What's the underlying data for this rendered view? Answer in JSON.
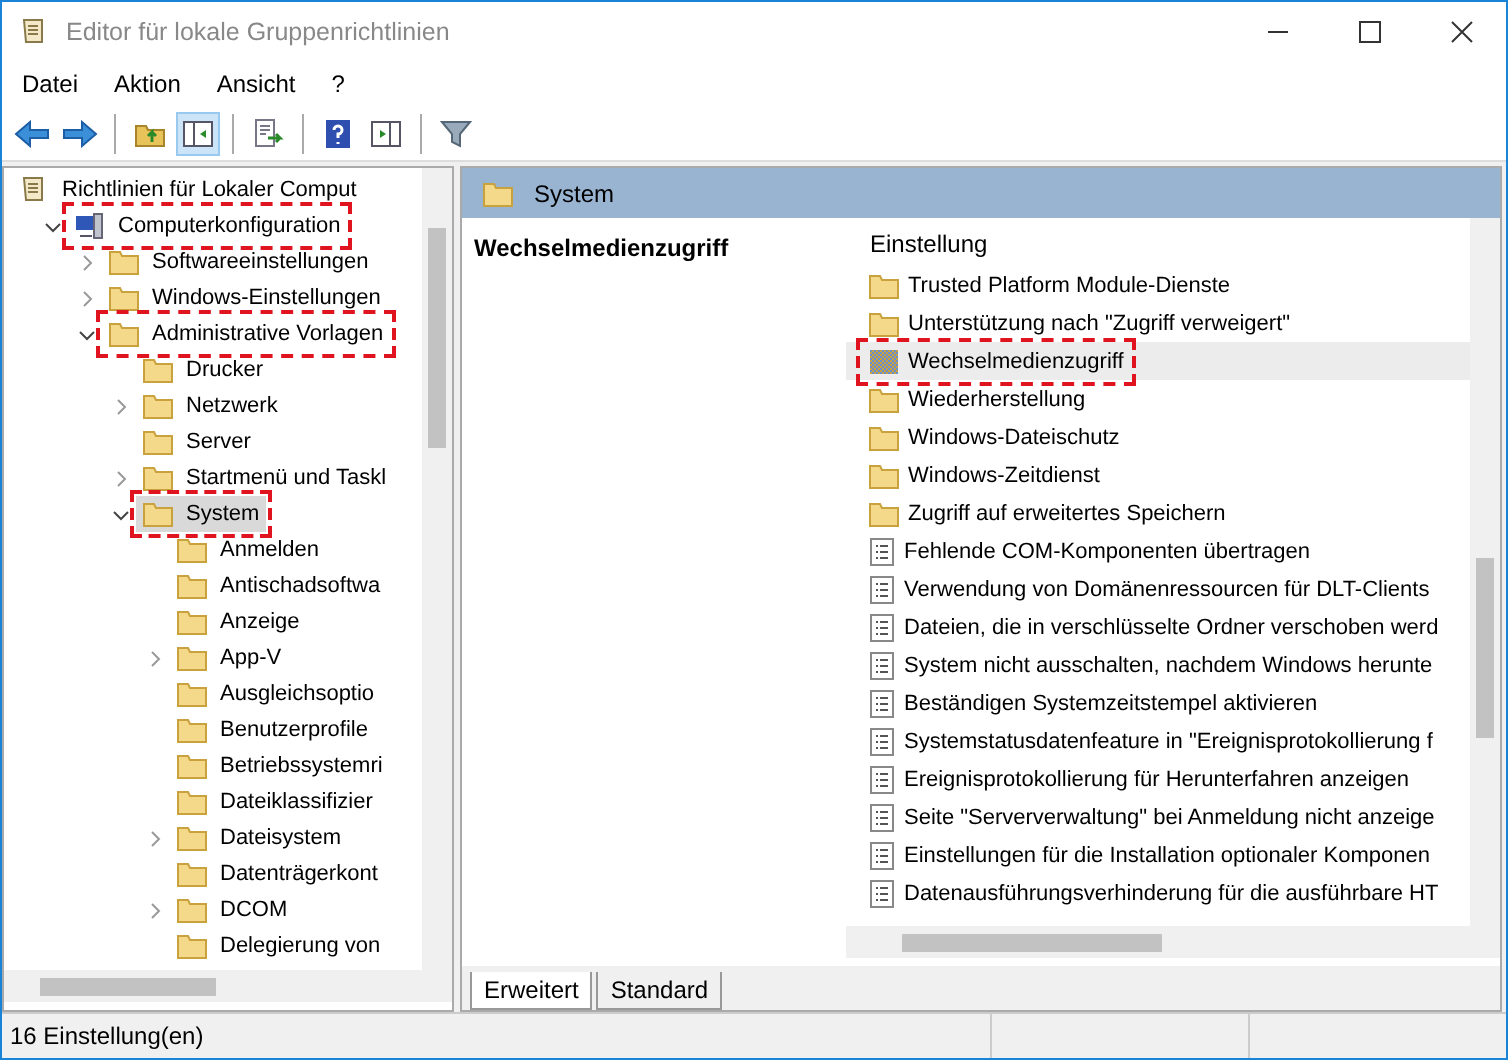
{
  "window": {
    "title": "Editor für lokale Gruppenrichtlinien"
  },
  "menu": [
    "Datei",
    "Aktion",
    "Ansicht",
    "?"
  ],
  "toolbar": [
    {
      "kind": "back",
      "pressed": false
    },
    {
      "kind": "forward",
      "pressed": false
    },
    {
      "kind": "separator"
    },
    {
      "kind": "up",
      "pressed": false
    },
    {
      "kind": "tree",
      "pressed": true
    },
    {
      "kind": "separator"
    },
    {
      "kind": "export",
      "pressed": false
    },
    {
      "kind": "separator"
    },
    {
      "kind": "help",
      "pressed": false
    },
    {
      "kind": "pane",
      "pressed": false
    },
    {
      "kind": "separator"
    },
    {
      "kind": "filter",
      "pressed": false
    }
  ],
  "tree": {
    "label": "Richtlinien für Lokaler Comput",
    "kind": "scroll",
    "selected": false,
    "highlighted": false,
    "children": [
      {
        "label": "Computerkonfiguration",
        "kind": "computer",
        "expanded": true,
        "selected": false,
        "highlighted": true,
        "children": [
          {
            "label": "Softwareeinstellungen",
            "kind": "folder",
            "expanded": false,
            "selected": false,
            "highlighted": false
          },
          {
            "label": "Windows-Einstellungen",
            "kind": "folder",
            "expanded": false,
            "selected": false,
            "highlighted": false
          },
          {
            "label": "Administrative Vorlagen",
            "kind": "folder",
            "expanded": true,
            "selected": false,
            "highlighted": true,
            "children": [
              {
                "label": "Drucker",
                "kind": "folder",
                "selected": false,
                "highlighted": false
              },
              {
                "label": "Netzwerk",
                "kind": "folder",
                "expanded": false,
                "selected": false,
                "highlighted": false
              },
              {
                "label": "Server",
                "kind": "folder",
                "selected": false,
                "highlighted": false
              },
              {
                "label": "Startmenü und Taskl",
                "kind": "folder",
                "expanded": false,
                "selected": false,
                "highlighted": false
              },
              {
                "label": "System",
                "kind": "folder",
                "expanded": true,
                "selected": true,
                "highlighted": true,
                "children": [
                  {
                    "label": "Anmelden",
                    "kind": "folder",
                    "selected": false,
                    "highlighted": false
                  },
                  {
                    "label": "Antischadsoftwa",
                    "kind": "folder",
                    "selected": false,
                    "highlighted": false
                  },
                  {
                    "label": "Anzeige",
                    "kind": "folder",
                    "selected": false,
                    "highlighted": false
                  },
                  {
                    "label": "App-V",
                    "kind": "folder",
                    "expanded": false,
                    "selected": false,
                    "highlighted": false
                  },
                  {
                    "label": "Ausgleichsoptio",
                    "kind": "folder",
                    "selected": false,
                    "highlighted": false
                  },
                  {
                    "label": "Benutzerprofile",
                    "kind": "folder",
                    "selected": false,
                    "highlighted": false
                  },
                  {
                    "label": "Betriebssystemri",
                    "kind": "folder",
                    "selected": false,
                    "highlighted": false
                  },
                  {
                    "label": "Dateiklassifizier",
                    "kind": "folder",
                    "selected": false,
                    "highlighted": false
                  },
                  {
                    "label": "Dateisystem",
                    "kind": "folder",
                    "expanded": false,
                    "selected": false,
                    "highlighted": false
                  },
                  {
                    "label": "Datenträgerkont",
                    "kind": "folder",
                    "selected": false,
                    "highlighted": false
                  },
                  {
                    "label": "DCOM",
                    "kind": "folder",
                    "expanded": false,
                    "selected": false,
                    "highlighted": false
                  },
                  {
                    "label": "Delegierung von",
                    "kind": "folder",
                    "selected": false,
                    "highlighted": false
                  }
                ]
              }
            ]
          }
        ]
      }
    ]
  },
  "content_header": {
    "title": "System"
  },
  "description": {
    "title": "Wechselmedienzugriff"
  },
  "list": {
    "column": "Einstellung",
    "rows": [
      {
        "label": "Trusted Platform Module-Dienste",
        "kind": "folder",
        "selected": false,
        "highlighted": false
      },
      {
        "label": "Unterstützung nach \"Zugriff verweigert\"",
        "kind": "folder",
        "selected": false,
        "highlighted": false
      },
      {
        "label": "Wechselmedienzugriff",
        "kind": "policy-folder",
        "selected": true,
        "highlighted": true
      },
      {
        "label": "Wiederherstellung",
        "kind": "folder",
        "selected": false,
        "highlighted": false
      },
      {
        "label": "Windows-Dateischutz",
        "kind": "folder",
        "selected": false,
        "highlighted": false
      },
      {
        "label": "Windows-Zeitdienst",
        "kind": "folder",
        "selected": false,
        "highlighted": false
      },
      {
        "label": "Zugriff auf erweitertes Speichern",
        "kind": "folder",
        "selected": false,
        "highlighted": false
      },
      {
        "label": "Fehlende COM-Komponenten übertragen",
        "kind": "setting",
        "selected": false,
        "highlighted": false
      },
      {
        "label": "Verwendung von Domänenressourcen für DLT-Clients",
        "kind": "setting",
        "selected": false,
        "highlighted": false
      },
      {
        "label": "Dateien, die in verschlüsselte Ordner verschoben werd",
        "kind": "setting",
        "selected": false,
        "highlighted": false
      },
      {
        "label": "System nicht ausschalten, nachdem Windows herunte",
        "kind": "setting",
        "selected": false,
        "highlighted": false
      },
      {
        "label": "Beständigen Systemzeitstempel aktivieren",
        "kind": "setting",
        "selected": false,
        "highlighted": false
      },
      {
        "label": "Systemstatusdatenfeature in \"Ereignisprotokollierung f",
        "kind": "setting",
        "selected": false,
        "highlighted": false
      },
      {
        "label": "Ereignisprotokollierung für Herunterfahren anzeigen",
        "kind": "setting",
        "selected": false,
        "highlighted": false
      },
      {
        "label": "Seite \"Serververwaltung\" bei Anmeldung nicht anzeige",
        "kind": "setting",
        "selected": false,
        "highlighted": false
      },
      {
        "label": "Einstellungen für die Installation optionaler Komponen",
        "kind": "setting",
        "selected": false,
        "highlighted": false
      },
      {
        "label": "Datenausführungsverhinderung für die ausführbare HT",
        "kind": "setting",
        "selected": false,
        "highlighted": false
      }
    ]
  },
  "tabs": [
    {
      "label": "Erweitert",
      "selected": true
    },
    {
      "label": "Standard",
      "selected": false
    }
  ],
  "status_bar": {
    "text": "16 Einstellung(en)"
  }
}
